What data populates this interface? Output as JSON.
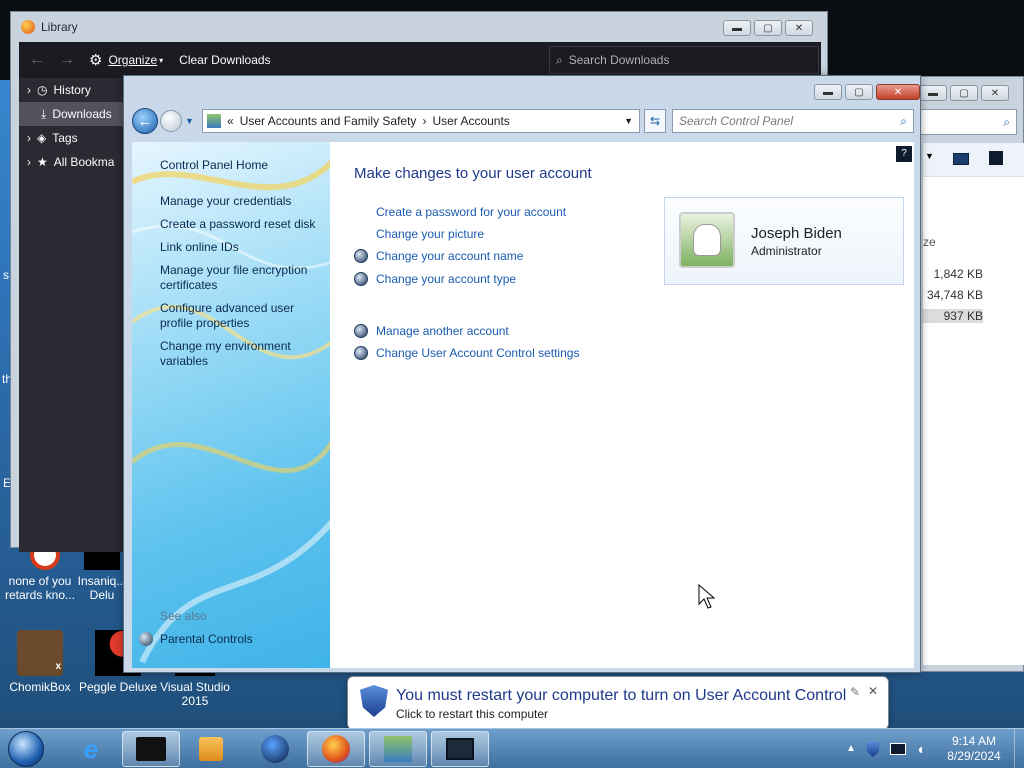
{
  "desktop": {
    "edge_texts": [
      "s",
      "th",
      "E"
    ],
    "icons": [
      {
        "label": "none of you retards kno...",
        "icon": "app-red-icon"
      },
      {
        "label": "Insaniq... Delu",
        "icon": "app-icon"
      },
      {
        "label": "ChomikBox",
        "icon": "chomikbox-icon",
        "badge": "x"
      },
      {
        "label": "Peggle Deluxe",
        "icon": "peggle-icon"
      },
      {
        "label": "Visual Studio 2015",
        "icon": "visual-studio-icon"
      }
    ]
  },
  "library_window": {
    "title": "Library",
    "toolbar": {
      "organize": "Organize",
      "clear_downloads": "Clear Downloads",
      "search_placeholder": "Search Downloads"
    },
    "sidebar": [
      {
        "label": "History",
        "icon": "clock-icon",
        "expander": true,
        "selected": false
      },
      {
        "label": "Downloads",
        "icon": "download-icon",
        "expander": false,
        "selected": true
      },
      {
        "label": "Tags",
        "icon": "tag-icon",
        "expander": true,
        "selected": false
      },
      {
        "label": "All Bookma",
        "icon": "star-icon",
        "expander": true,
        "selected": false
      }
    ]
  },
  "explorer_window": {
    "column_fragment": "ze",
    "sizes": [
      "1,842 KB",
      "34,748 KB",
      "937 KB"
    ]
  },
  "control_panel": {
    "address": {
      "prefix": "«",
      "segment1": "User Accounts and Family Safety",
      "separator": "›",
      "segment2": "User Accounts"
    },
    "search_placeholder": "Search Control Panel",
    "left_pane": {
      "home": "Control Panel Home",
      "links": [
        "Manage your credentials",
        "Create a password reset disk",
        "Link online IDs",
        "Manage your file encryption certificates",
        "Configure advanced user profile properties",
        "Change my environment variables"
      ],
      "see_also": "See also",
      "parental_controls": "Parental Controls"
    },
    "heading": "Make changes to your user account",
    "tasks": [
      {
        "label": "Create a password for your account",
        "shield": false
      },
      {
        "label": "Change your picture",
        "shield": false
      },
      {
        "label": "Change your account name",
        "shield": true
      },
      {
        "label": "Change your account type",
        "shield": true
      }
    ],
    "tasks2": [
      {
        "label": "Manage another account",
        "shield": true
      },
      {
        "label": "Change User Account Control settings",
        "shield": true
      }
    ],
    "user": {
      "name": "Joseph Biden",
      "role": "Administrator"
    }
  },
  "notification": {
    "title": "You must restart your computer to turn on User Account Control",
    "subtitle": "Click to restart this computer"
  },
  "taskbar": {
    "clock_time": "9:14 AM",
    "clock_date": "8/29/2024"
  }
}
